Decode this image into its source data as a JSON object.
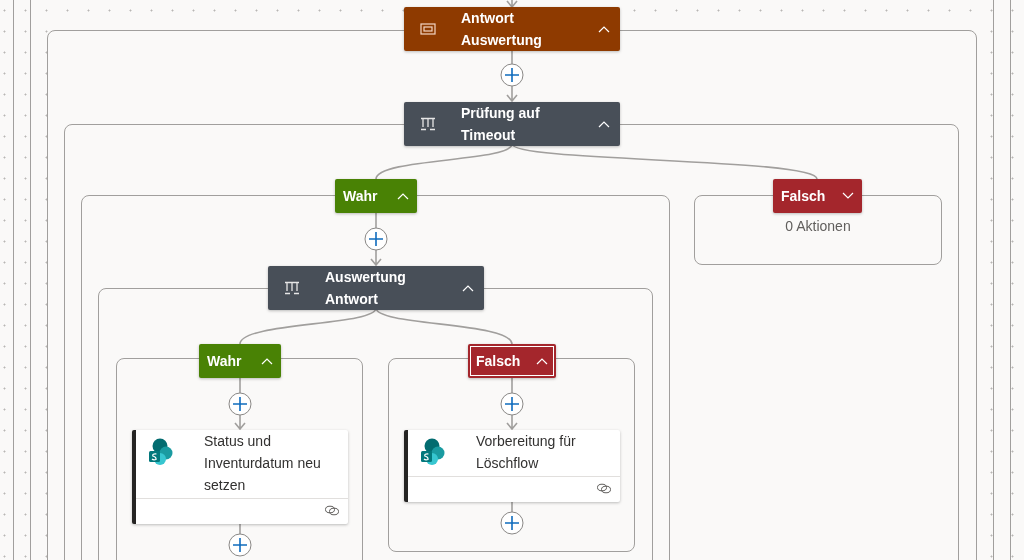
{
  "nodes": [
    {
      "kind": "scope",
      "title": "Antwort Auswertung",
      "expanded": true,
      "selected": false
    },
    {
      "kind": "condition",
      "title": "Prüfung auf Timeout",
      "expanded": true,
      "selected": false
    },
    {
      "kind": "true",
      "title": "Wahr",
      "expanded": true,
      "selected": false
    },
    {
      "kind": "false",
      "title": "Falsch",
      "expanded": false,
      "selected": false
    },
    {
      "kind": "condition",
      "title": "Auswertung Antwort",
      "expanded": true,
      "selected": false
    },
    {
      "kind": "true",
      "title": "Wahr",
      "expanded": true,
      "selected": false
    },
    {
      "kind": "false",
      "title": "Falsch",
      "expanded": true,
      "selected": true
    },
    {
      "kind": "action",
      "title": "Status und Inventurdatum neu setzen",
      "selected": false
    },
    {
      "kind": "action",
      "title": "Vorbereitung für Löschflow",
      "selected": false
    }
  ],
  "empty_branch_note": "0 Aktionen"
}
